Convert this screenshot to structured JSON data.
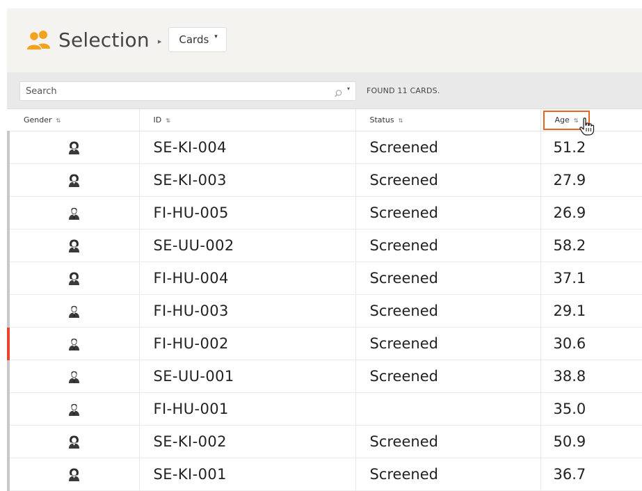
{
  "header": {
    "title": "Selection",
    "breadcrumb_sep": "▸",
    "view_selector": {
      "value": "Cards",
      "caret": "▾"
    },
    "icon": "users-group-icon",
    "accent_color": "#f3a21d"
  },
  "filter_bar": {
    "search_placeholder": "Search",
    "search_icon": "search-icon",
    "search_caret": "▾",
    "found_text": "FOUND 11 CARDS."
  },
  "table": {
    "columns": [
      {
        "label": "Gender",
        "sort": "⇅"
      },
      {
        "label": "ID",
        "sort": "⇅"
      },
      {
        "label": "Status",
        "sort": "⇅"
      },
      {
        "label": "Age",
        "sort": "⇅",
        "highlighted": true
      }
    ],
    "highlight_color": "#e9651c",
    "flag_color": "#e8442e",
    "rows": [
      {
        "gender": "female",
        "id": "SE-KI-004",
        "status": "Screened",
        "age": "51.2"
      },
      {
        "gender": "female",
        "id": "SE-KI-003",
        "status": "Screened",
        "age": "27.9"
      },
      {
        "gender": "male",
        "id": "FI-HU-005",
        "status": "Screened",
        "age": "26.9"
      },
      {
        "gender": "female",
        "id": "SE-UU-002",
        "status": "Screened",
        "age": "58.2"
      },
      {
        "gender": "female",
        "id": "FI-HU-004",
        "status": "Screened",
        "age": "37.1"
      },
      {
        "gender": "male",
        "id": "FI-HU-003",
        "status": "Screened",
        "age": "29.1"
      },
      {
        "gender": "male",
        "id": "FI-HU-002",
        "status": "Screened",
        "age": "30.6",
        "flag": true
      },
      {
        "gender": "male",
        "id": "SE-UU-001",
        "status": "Screened",
        "age": "38.8"
      },
      {
        "gender": "male",
        "id": "FI-HU-001",
        "status": "",
        "age": "35.0"
      },
      {
        "gender": "female",
        "id": "SE-KI-002",
        "status": "Screened",
        "age": "50.9"
      },
      {
        "gender": "female",
        "id": "SE-KI-001",
        "status": "Screened",
        "age": "36.7"
      }
    ]
  }
}
